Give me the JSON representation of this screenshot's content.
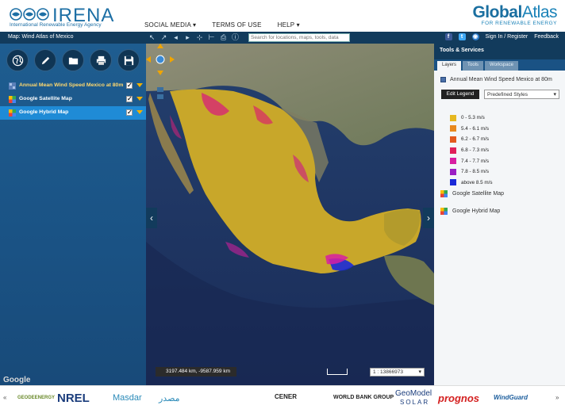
{
  "header": {
    "irena_word": "IRENA",
    "irena_sub": "International Renewable Energy Agency",
    "nav": [
      {
        "label": "SOCIAL MEDIA ▾"
      },
      {
        "label": "TERMS OF USE"
      },
      {
        "label": "HELP ▾"
      }
    ],
    "ga_word_bold": "Global",
    "ga_word_light": "Atlas",
    "ga_sub": "FOR RENEWABLE ENERGY"
  },
  "toolbar": {
    "map_title": "Map: Wind Atlas of Mexico",
    "search_placeholder": "Search for locations, maps, tools, data",
    "signin": "Sign In / Register",
    "feedback": "Feedback"
  },
  "layers": [
    {
      "name": "Annual Mean Wind Speed Mexico at 80m",
      "checked": true
    },
    {
      "name": "Google Satellite Map",
      "checked": true
    },
    {
      "name": "Google Hybrid Map",
      "checked": true
    }
  ],
  "map": {
    "coords": "3197.484 km, -9587.959 km",
    "scale": "1 : 13866973",
    "google": "Google"
  },
  "right_panel": {
    "title": "Tools & Services",
    "tabs": [
      "Layers",
      "Tools",
      "Workspace"
    ],
    "wind_layer": "Annual Mean Wind Speed Mexico at 80m",
    "edit_legend": "Edit Legend",
    "style_select": "Predefined Styles",
    "legend": [
      {
        "label": "0 - 5.3 m/s",
        "color": "#e6b820"
      },
      {
        "label": "5.4 - 6.1 m/s",
        "color": "#e8891e"
      },
      {
        "label": "6.2 - 6.7 m/s",
        "color": "#e35a1e"
      },
      {
        "label": "6.8 - 7.3 m/s",
        "color": "#e0205a"
      },
      {
        "label": "7.4 - 7.7 m/s",
        "color": "#d81fa2"
      },
      {
        "label": "7.8 - 8.5 m/s",
        "color": "#9b1fc4"
      },
      {
        "label": "above 8.5 m/s",
        "color": "#1a2ad8"
      }
    ],
    "satellite_layer": "Google Satellite Map",
    "hybrid_layer": "Google Hybrid Map"
  },
  "footer": {
    "partners": [
      "GEODEENERGY",
      "NREL",
      "Masdar",
      "مصدر",
      "CENER",
      "WORLD BANK GROUP",
      "GeoModel",
      "SOLAR",
      "prognos",
      "WindGuard"
    ]
  }
}
